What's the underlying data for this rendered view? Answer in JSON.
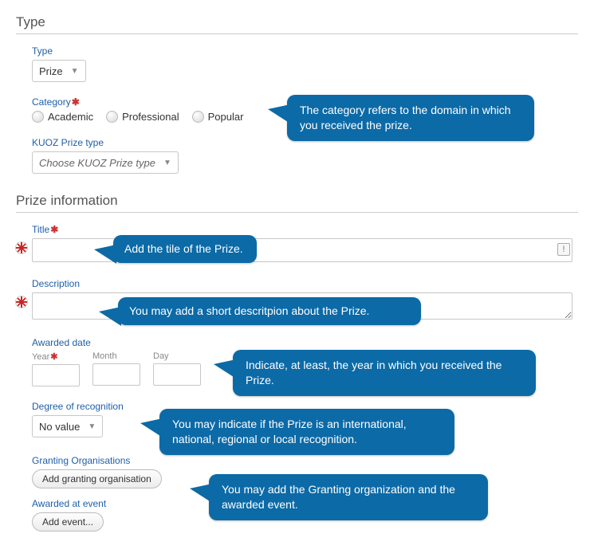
{
  "sections": {
    "type_heading": "Type",
    "prize_info_heading": "Prize information"
  },
  "type_block": {
    "type_label": "Type",
    "type_value": "Prize",
    "category_label": "Category",
    "category_options": [
      "Academic",
      "Professional",
      "Popular"
    ],
    "kuoz_label": "KUOZ Prize type",
    "kuoz_value": "Choose KUOZ Prize type"
  },
  "prize_info": {
    "title_label": "Title",
    "title_value": "",
    "description_label": "Description",
    "description_value": "",
    "awarded_date_label": "Awarded date",
    "date_cols": {
      "year": "Year",
      "month": "Month",
      "day": "Day"
    },
    "degree_label": "Degree of recognition",
    "degree_value": "No value",
    "granting_org_label": "Granting Organisations",
    "add_granting_btn": "Add granting organisation",
    "awarded_event_label": "Awarded at event",
    "add_event_btn": "Add event..."
  },
  "tooltips": {
    "category": "The category refers to the domain in which you received the prize.",
    "title": "Add the tile of the Prize.",
    "description": "You may add a short descritpion about the Prize.",
    "date": "Indicate, at least, the year in which you received the Prize.",
    "degree": "You may indicate if the Prize is an international, national, regional or local recognition.",
    "granting": "You may add the Granting organization and the awarded event."
  },
  "icons": {
    "alert": "!"
  }
}
